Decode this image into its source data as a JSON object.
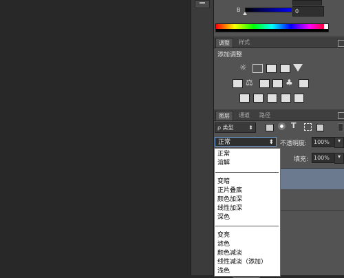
{
  "color_panel": {
    "b_label": "B",
    "value_top": "0",
    "value_b": "0"
  },
  "adjust_panel": {
    "tabs": [
      "调整",
      "样式"
    ],
    "title": "添加调整"
  },
  "layers_panel": {
    "tabs": [
      "图层",
      "通道",
      "路径"
    ],
    "filter_label": "ρ 类型",
    "blend_mode": "正常",
    "opacity_label": "不透明度:",
    "opacity_value": "100%",
    "fill_label": "填充:",
    "fill_value": "100%"
  },
  "blend_menu": {
    "group1": [
      "正常",
      "溶解"
    ],
    "group2": [
      "变暗",
      "正片叠底",
      "颜色加深",
      "线性加深",
      "深色"
    ],
    "group3": [
      "变亮",
      "滤色",
      "颜色减淡",
      "线性减淡（添加）",
      "浅色"
    ]
  },
  "colors": {
    "panel": "#535353",
    "dark": "#282828",
    "layer_highlight": "#6b7a8e"
  }
}
